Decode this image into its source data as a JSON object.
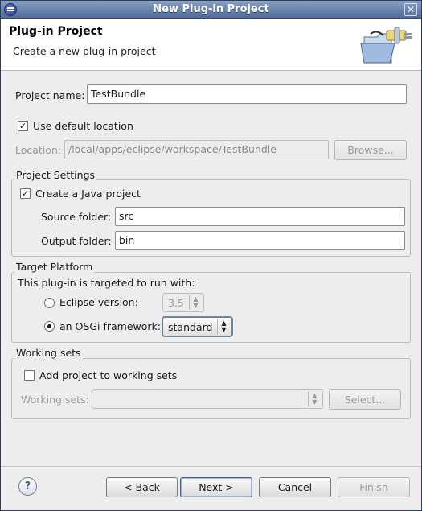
{
  "window": {
    "title": "New Plug-in Project"
  },
  "header": {
    "title": "Plug-in Project",
    "description": "Create a new plug-in project"
  },
  "project_name": {
    "label": "Project name:",
    "value": "TestBundle"
  },
  "location": {
    "use_default_label": "Use default location",
    "use_default_checked": true,
    "label": "Location:",
    "value": "/local/apps/eclipse/workspace/TestBundle",
    "browse_label": "Browse..."
  },
  "project_settings": {
    "title": "Project Settings",
    "java_project_label": "Create a Java project",
    "java_project_checked": true,
    "source_label": "Source folder:",
    "source_value": "src",
    "output_label": "Output folder:",
    "output_value": "bin"
  },
  "target_platform": {
    "title": "Target Platform",
    "intro": "This plug-in is targeted to run with:",
    "eclipse_label": "Eclipse version:",
    "eclipse_value": "3.5",
    "osgi_label": "an OSGi framework:",
    "osgi_value": "standard",
    "selected": "osgi"
  },
  "working_sets": {
    "title": "Working sets",
    "add_label": "Add project to working sets",
    "add_checked": false,
    "sets_label": "Working sets:",
    "sets_value": "",
    "select_label": "Select..."
  },
  "footer": {
    "help_glyph": "?",
    "back_label": "< Back",
    "next_label": "Next >",
    "cancel_label": "Cancel",
    "finish_label": "Finish"
  },
  "icons": {
    "app": "eclipse-icon",
    "close": "close-icon",
    "wizard": "folder-plug-icon",
    "help": "help-icon",
    "combo": "up-down-arrows-icon"
  },
  "colors": {
    "titlebar": "#4f6b99",
    "dialog_bg": "#ededed",
    "header_bg": "#ffffff"
  }
}
